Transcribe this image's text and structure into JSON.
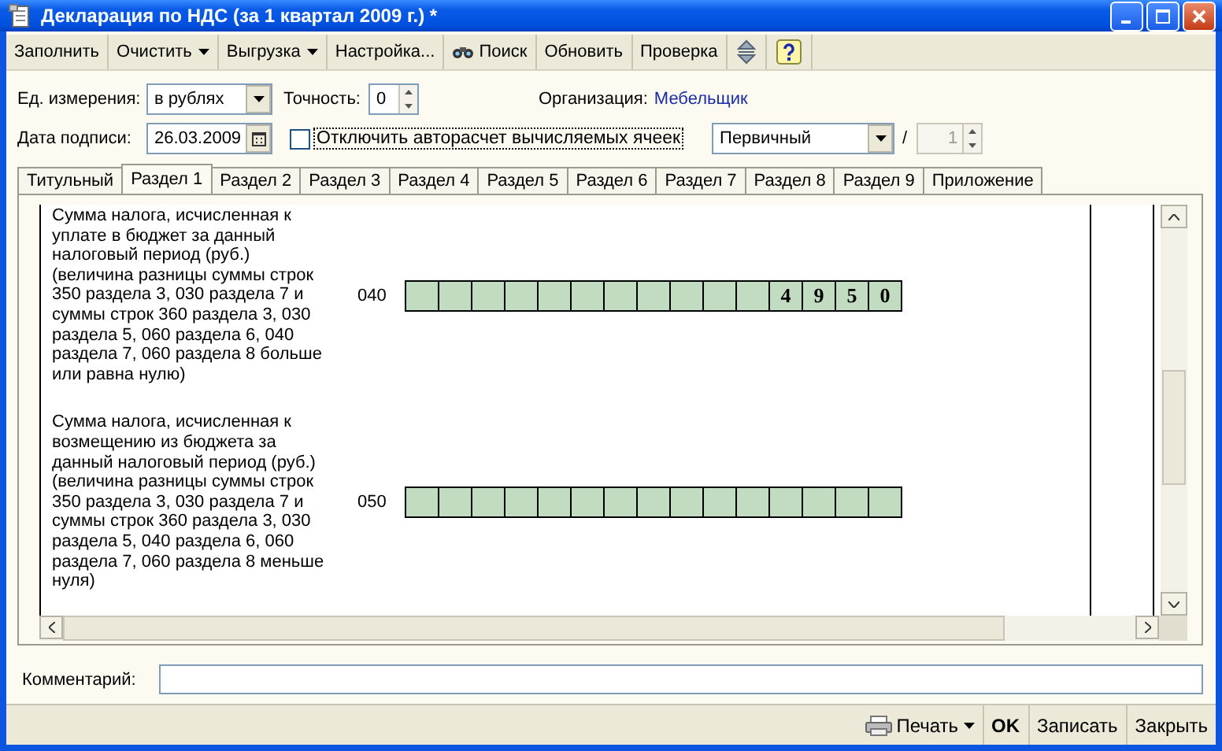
{
  "window": {
    "title": "Декларация по НДС (за 1 квартал 2009 г.) *"
  },
  "toolbar": [
    {
      "label": "Заполнить",
      "kind": "plain"
    },
    {
      "label": "Очистить",
      "kind": "menu"
    },
    {
      "label": "Выгрузка",
      "kind": "menu"
    },
    {
      "label": "Настройка...",
      "kind": "plain"
    },
    {
      "label": "Поиск",
      "kind": "search"
    },
    {
      "label": "Обновить",
      "kind": "plain"
    },
    {
      "label": "Проверка",
      "kind": "plain"
    }
  ],
  "form": {
    "units": {
      "label": "Ед. измерения:",
      "value": "в рублях"
    },
    "precision": {
      "label": "Точность:",
      "value": "0"
    },
    "organization": {
      "label": "Организация:",
      "value": "Мебельщик"
    },
    "sign_date": {
      "label": "Дата подписи:",
      "value": "26.03.2009"
    },
    "autocalc": {
      "label": "Отключить авторасчет вычисляемых ячеек",
      "checked": false
    },
    "report_type": {
      "value": "Первичный"
    },
    "correction": {
      "separator": "/",
      "value": "1",
      "disabled": true
    }
  },
  "tabs": [
    {
      "label": "Титульный",
      "selected": false
    },
    {
      "label": "Раздел 1",
      "selected": true
    },
    {
      "label": "Раздел 2",
      "selected": false
    },
    {
      "label": "Раздел 3",
      "selected": false
    },
    {
      "label": "Раздел 4",
      "selected": false
    },
    {
      "label": "Раздел 5",
      "selected": false
    },
    {
      "label": "Раздел 6",
      "selected": false
    },
    {
      "label": "Раздел 7",
      "selected": false
    },
    {
      "label": "Раздел 8",
      "selected": false
    },
    {
      "label": "Раздел 9",
      "selected": false
    },
    {
      "label": "Приложение",
      "selected": false
    }
  ],
  "section": {
    "lines": [
      {
        "description": "Сумма налога, исчисленная к уплате в бюджет за данный налоговый период (руб.) (величина разницы суммы строк 350 раздела 3, 030 раздела 7 и суммы строк 360 раздела 3, 030 раздела 5, 060 раздела 6, 040 раздела 7, 060 раздела 8 больше или равна нулю)",
        "code": "040",
        "digits": [
          "4",
          "9",
          "5",
          "0"
        ]
      },
      {
        "description": "Сумма налога, исчисленная к возмещению из бюджета за данный налоговый период (руб.) (величина разницы суммы строк 350 раздела 3, 030 раздела 7 и суммы строк 360 раздела 3, 030 раздела 5, 040 раздела 6,  060 раздела 7, 060 раздела 8 меньше нуля)",
        "code": "050"
      }
    ]
  },
  "comment": {
    "label": "Комментарий:"
  },
  "footer": [
    {
      "label": "Печать",
      "kind": "print"
    },
    {
      "label": "OK",
      "kind": "default"
    },
    {
      "label": "Записать",
      "kind": "plain"
    },
    {
      "label": "Закрыть",
      "kind": "plain"
    }
  ]
}
